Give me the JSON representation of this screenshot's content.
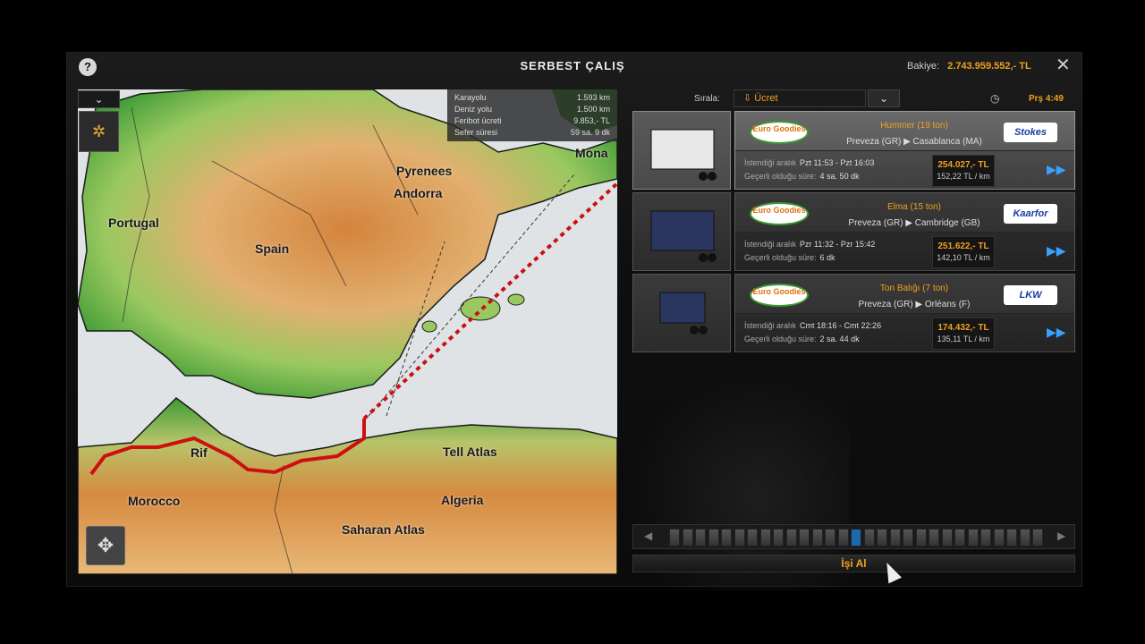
{
  "header": {
    "title": "SERBEST ÇALIŞ",
    "balance_label": "Bakiye:",
    "balance_value": "2.743.959.552,- TL",
    "help_glyph": "?",
    "close_glyph": "✕"
  },
  "map": {
    "dropdown_glyph": "⌄",
    "labels": {
      "portugal": "Portugal",
      "spain": "Spain",
      "pyrenees": "Pyrenees",
      "andorra": "Andorra",
      "monaco": "Mona",
      "rif": "Rif",
      "tell_atlas": "Tell Atlas",
      "morocco": "Morocco",
      "algeria": "Algeria",
      "saharan_atlas": "Saharan Atlas"
    },
    "route_info": [
      {
        "label": "Karayolu",
        "value": "1.593 km"
      },
      {
        "label": "Deniz yolu",
        "value": "1.500 km"
      },
      {
        "label": "Feribot ücreti",
        "value": "9.853,- TL"
      },
      {
        "label": "Sefer süresi",
        "value": "59 sa. 9 dk"
      }
    ],
    "colors": {
      "route": "#cc1010",
      "sea": "#dfe3e6",
      "low": "#4caa3c",
      "mid": "#d99a50"
    }
  },
  "sort": {
    "label": "Sırala:",
    "selected": "⇩ Ücret",
    "time": "Prş 4:49"
  },
  "jobs": [
    {
      "source_logo": "Euro Goodies",
      "cargo": "Hummer (19 ton)",
      "route": "Preveza (GR) ▶ Casablanca (MA)",
      "dest_logo": "Stokes",
      "window_label": "İstendiği aralık",
      "window_value": "Pzt 11:53 - Pzt 16:03",
      "valid_label": "Geçerli olduğu süre:",
      "valid_value": "4 sa. 50 dk",
      "pay": "254.027,- TL",
      "rate": "152,22 TL / km",
      "selected": true
    },
    {
      "source_logo": "Euro Goodies",
      "cargo": "Elma (15 ton)",
      "route": "Preveza (GR) ▶ Cambridge (GB)",
      "dest_logo": "Kaarfor",
      "window_label": "İstendiği aralık",
      "window_value": "Pzr 11:32 - Pzr 15:42",
      "valid_label": "Geçerli olduğu süre:",
      "valid_value": "6 dk",
      "pay": "251.622,- TL",
      "rate": "142,10 TL / km",
      "selected": false
    },
    {
      "source_logo": "Euro Goodies",
      "cargo": "Ton Balığı (7 ton)",
      "route": "Preveza (GR) ▶ Orléans (F)",
      "dest_logo": "LKW",
      "window_label": "İstendiği aralık",
      "window_value": "Cmt 18:16 - Cmt 22:26",
      "valid_label": "Geçerli olduğu süre:",
      "valid_value": "2 sa. 44 dk",
      "pay": "174.432,- TL",
      "rate": "135,11 TL / km",
      "selected": false
    }
  ],
  "slider": {
    "total": 29,
    "active_index": 14
  },
  "take_button": "İşi Al"
}
